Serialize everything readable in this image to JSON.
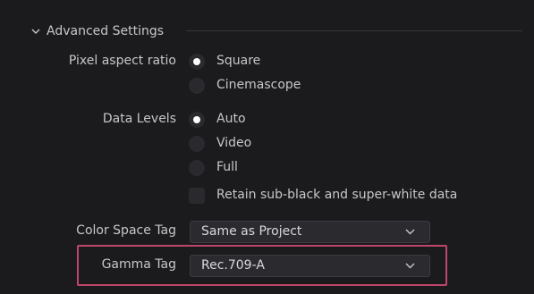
{
  "advanced_settings": {
    "header_label": "Advanced Settings",
    "header_icon": "chevron-down-icon"
  },
  "pixel_aspect_ratio": {
    "label": "Pixel aspect ratio",
    "options": [
      {
        "label": "Square",
        "checked": true
      },
      {
        "label": "Cinemascope",
        "checked": false
      }
    ]
  },
  "data_levels": {
    "label": "Data Levels",
    "options": [
      {
        "label": "Auto",
        "checked": true
      },
      {
        "label": "Video",
        "checked": false
      },
      {
        "label": "Full",
        "checked": false
      }
    ],
    "retain_label": "Retain sub-black and super-white data",
    "retain_checked": false
  },
  "color_space_tag": {
    "label": "Color Space Tag",
    "value": "Same as Project"
  },
  "gamma_tag": {
    "label": "Gamma Tag",
    "value": "Rec.709-A"
  },
  "colors": {
    "background": "#1b1b1e",
    "text": "#c7c7c9",
    "highlight": "#c0456a"
  }
}
